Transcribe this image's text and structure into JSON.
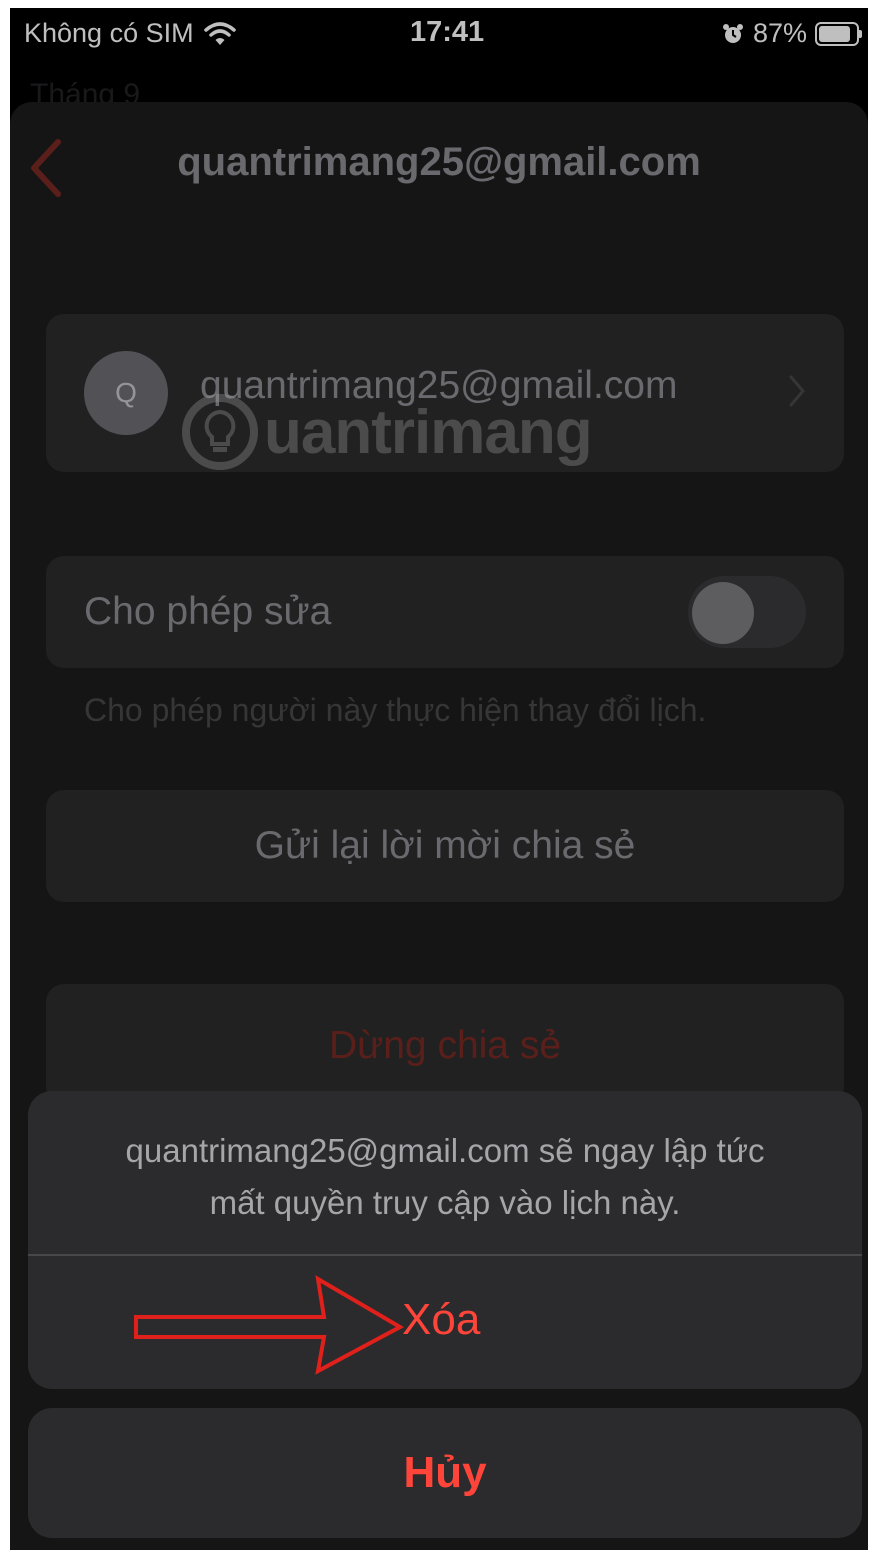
{
  "status_bar": {
    "carrier": "Không có SIM",
    "time": "17:41",
    "battery_percent": "87%",
    "battery_level": 0.87,
    "icons": [
      "wifi-icon",
      "alarm-icon",
      "battery-icon"
    ]
  },
  "background_header": {
    "title": "Tháng 9"
  },
  "nav": {
    "title": "quantrimang25@gmail.com",
    "back_icon": "chevron-left-icon"
  },
  "account_row": {
    "avatar_initial": "Q",
    "email": "quantrimang25@gmail.com",
    "chevron_icon": "chevron-right-icon"
  },
  "allow_edit": {
    "label": "Cho phép sửa",
    "enabled": false,
    "footnote": "Cho phép người này thực hiện thay đổi lịch."
  },
  "resend_button": "Gửi lại lời mời chia sẻ",
  "stop_sharing_button": "Dừng chia sẻ",
  "action_sheet": {
    "message_line1": "quantrimang25@gmail.com  sẽ ngay lập tức",
    "message_line2": "mất quyền truy cập vào lịch này.",
    "delete_label": "Xóa",
    "cancel_label": "Hủy"
  },
  "watermark": "uantrimang",
  "colors": {
    "destructive": "#ff453a",
    "sheet_bg": "#1c1c1e",
    "card_bg": "#2c2c2e",
    "annotation_arrow": "#e0201b"
  }
}
